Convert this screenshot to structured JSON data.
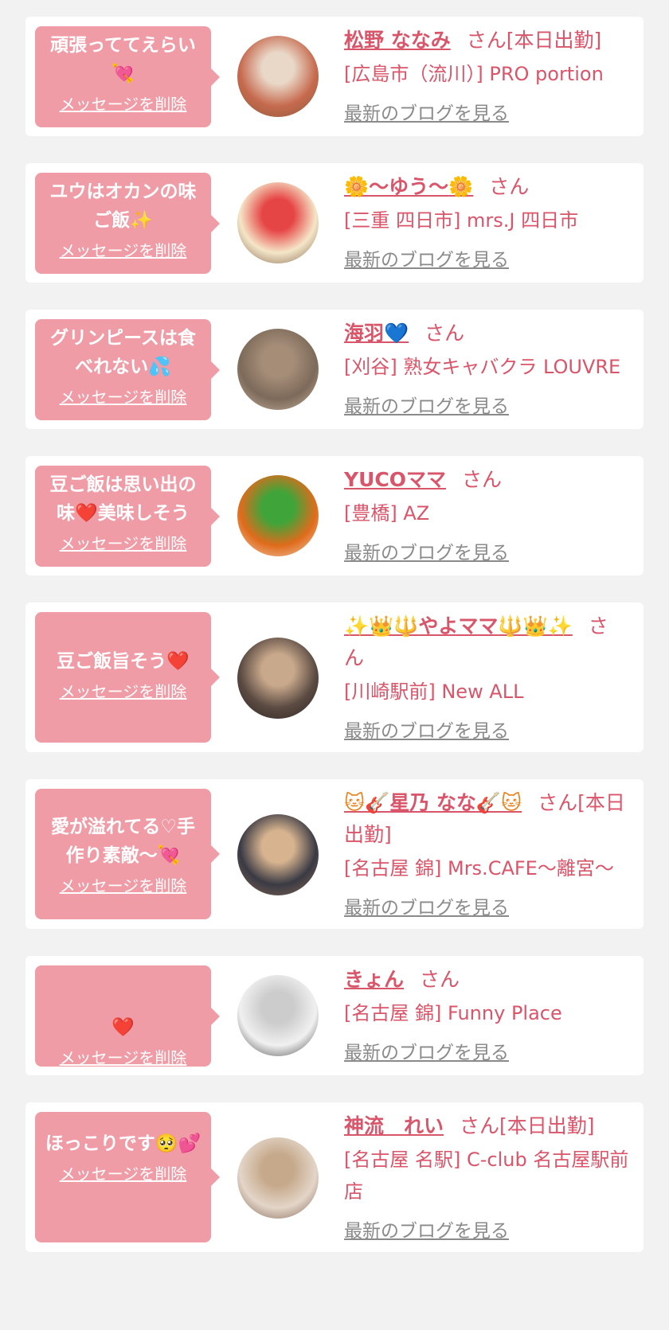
{
  "delete_label": "メッセージを削除",
  "blog_label": "最新のブログを見る",
  "entries": [
    {
      "msg1": "頑張っててえらい",
      "msg2": "",
      "msg_icon": "💘",
      "name": "松野 ななみ",
      "suffix": "さん[本日出勤]",
      "shop": "[広島市（流川）] PRO portion",
      "avatar_colors": [
        "#c66a4e",
        "#e9d7c7",
        "#8a5a3c"
      ]
    },
    {
      "msg1": "ユウはオカンの味",
      "msg2": "ご飯",
      "msg_icon": "✨",
      "name_prefix": "🌼",
      "name": "〜ゆう〜",
      "name_suffix": "🌼",
      "suffix": "さん",
      "shop": "[三重 四日市] mrs.J 四日市",
      "avatar_colors": [
        "#f5e6c8",
        "#e64545",
        "#7a5c45"
      ]
    },
    {
      "msg1": "グリンピースは食",
      "msg2": "べれない",
      "msg_icon": "💦",
      "name": "海羽",
      "name_suffix": "💙",
      "suffix": "さん",
      "shop": "[刈谷] 熟女キャバクラ LOUVRE",
      "avatar_colors": [
        "#7d6a5a",
        "#a58d78",
        "#c9b5a0"
      ]
    },
    {
      "msg1": "豆ご飯は思い出の",
      "msg2": "味❤️美味しそう",
      "msg_icon": "",
      "name": "YUCOママ",
      "suffix": "さん",
      "shop": "[豊橋] AZ",
      "avatar_colors": [
        "#e06b1c",
        "#3fa53a",
        "#f0d8c0"
      ]
    },
    {
      "msg1": "豆ご飯旨そう",
      "msg2": "",
      "msg_icon": "❤️",
      "name_prefix": "✨👑🔱",
      "name": "やよママ",
      "name_suffix": "🔱👑✨",
      "suffix": "さ\nん",
      "shop": "[川崎駅前] New ALL",
      "avatar_colors": [
        "#5a4a42",
        "#c9a98c",
        "#2e2622"
      ]
    },
    {
      "msg1": "愛が溢れてる♡手",
      "msg2": "作り素敵〜",
      "msg_icon": "💘",
      "name_prefix": "🐱🎸",
      "name": "星乃 なな",
      "name_suffix": "🎸🐱",
      "suffix": "さん[本日出勤]",
      "shop": "[名古屋 錦] Mrs.CAFE〜離宮〜",
      "avatar_colors": [
        "#3a3a44",
        "#d7b48f",
        "#8b6b55"
      ]
    },
    {
      "msg1": "",
      "msg2": "",
      "msg_icon": "❤️",
      "name": "きょん",
      "suffix": "さん",
      "shop": "[名古屋 錦] Funny Place",
      "avatar_colors": [
        "#f0f0f0",
        "#cccccc",
        "#3a3a3a"
      ]
    },
    {
      "msg1": "ほっこりです",
      "msg2": "",
      "msg_icon": "🥺💕",
      "name": "神流　れい",
      "suffix": "さん[本日出勤]",
      "shop": "[名古屋 名駅] C-club 名古屋駅前店",
      "avatar_colors": [
        "#e3d5c8",
        "#c6a98b",
        "#7a5d4c"
      ]
    }
  ]
}
